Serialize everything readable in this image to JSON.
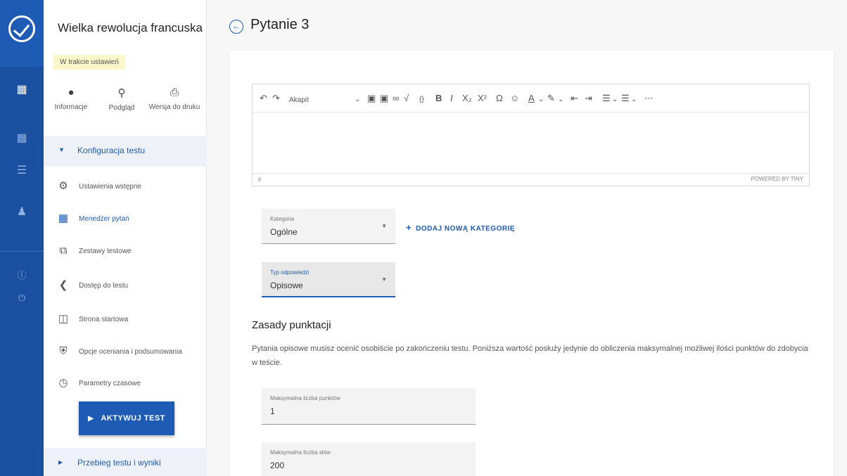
{
  "rail": {
    "icons": [
      "logo-icon",
      "question-bank-icon",
      "users-icon",
      "list-icon",
      "person-icon",
      "help-icon",
      "power-icon"
    ]
  },
  "sidebar": {
    "test_title": "Wielka rewolucja francuska",
    "status": "W trakcie ustawień",
    "actions": [
      {
        "label": "Informacje",
        "icon": "info-icon"
      },
      {
        "label": "Podgląd",
        "icon": "search-icon"
      },
      {
        "label": "Wersja do druku",
        "icon": "print-icon"
      }
    ],
    "section_config": "Konfiguracja testu",
    "items": [
      {
        "label": "Ustawienia wstępne",
        "icon": "gear-icon"
      },
      {
        "label": "Menedżer pytań",
        "icon": "question-manager-icon"
      },
      {
        "label": "Zestawy testowe",
        "icon": "test-sets-icon"
      },
      {
        "label": "Dostęp do testu",
        "icon": "share-icon"
      },
      {
        "label": "Strona startowa",
        "icon": "start-page-icon"
      },
      {
        "label": "Opcje oceniania i podsumowania",
        "icon": "shield-check-icon"
      },
      {
        "label": "Parametry czasowe",
        "icon": "clock-icon"
      }
    ],
    "activate_label": "AKTYWUJ TEST",
    "section_results": "Przebieg testu i wyniki"
  },
  "main": {
    "title": "Pytanie 3",
    "editor": {
      "paragraph_select": "Akapit",
      "status_path": "p",
      "powered_by": "POWERED BY TINY"
    },
    "category": {
      "label": "Kategoria",
      "value": "Ogólne"
    },
    "add_category": "DODAJ NOWĄ KATEGORIĘ",
    "answer_type": {
      "label": "Typ odpowiedzi",
      "value": "Opisowe"
    },
    "scoring_title": "Zasady punktacji",
    "scoring_desc": "Pytania opisowe musisz ocenić osobiście po zakończeniu testu. Poniższa wartość posłuży jedynie do obliczenia maksymalnej możliwej ilości punktów do zdobycia w teście.",
    "max_points": {
      "label": "Maksymalna liczba punktów",
      "value": "1"
    },
    "max_chars": {
      "label": "Maksymalna liczba słów",
      "value": "200"
    }
  },
  "colors": {
    "accent": "#1d5bb5",
    "badge": "#fbf7c9"
  }
}
